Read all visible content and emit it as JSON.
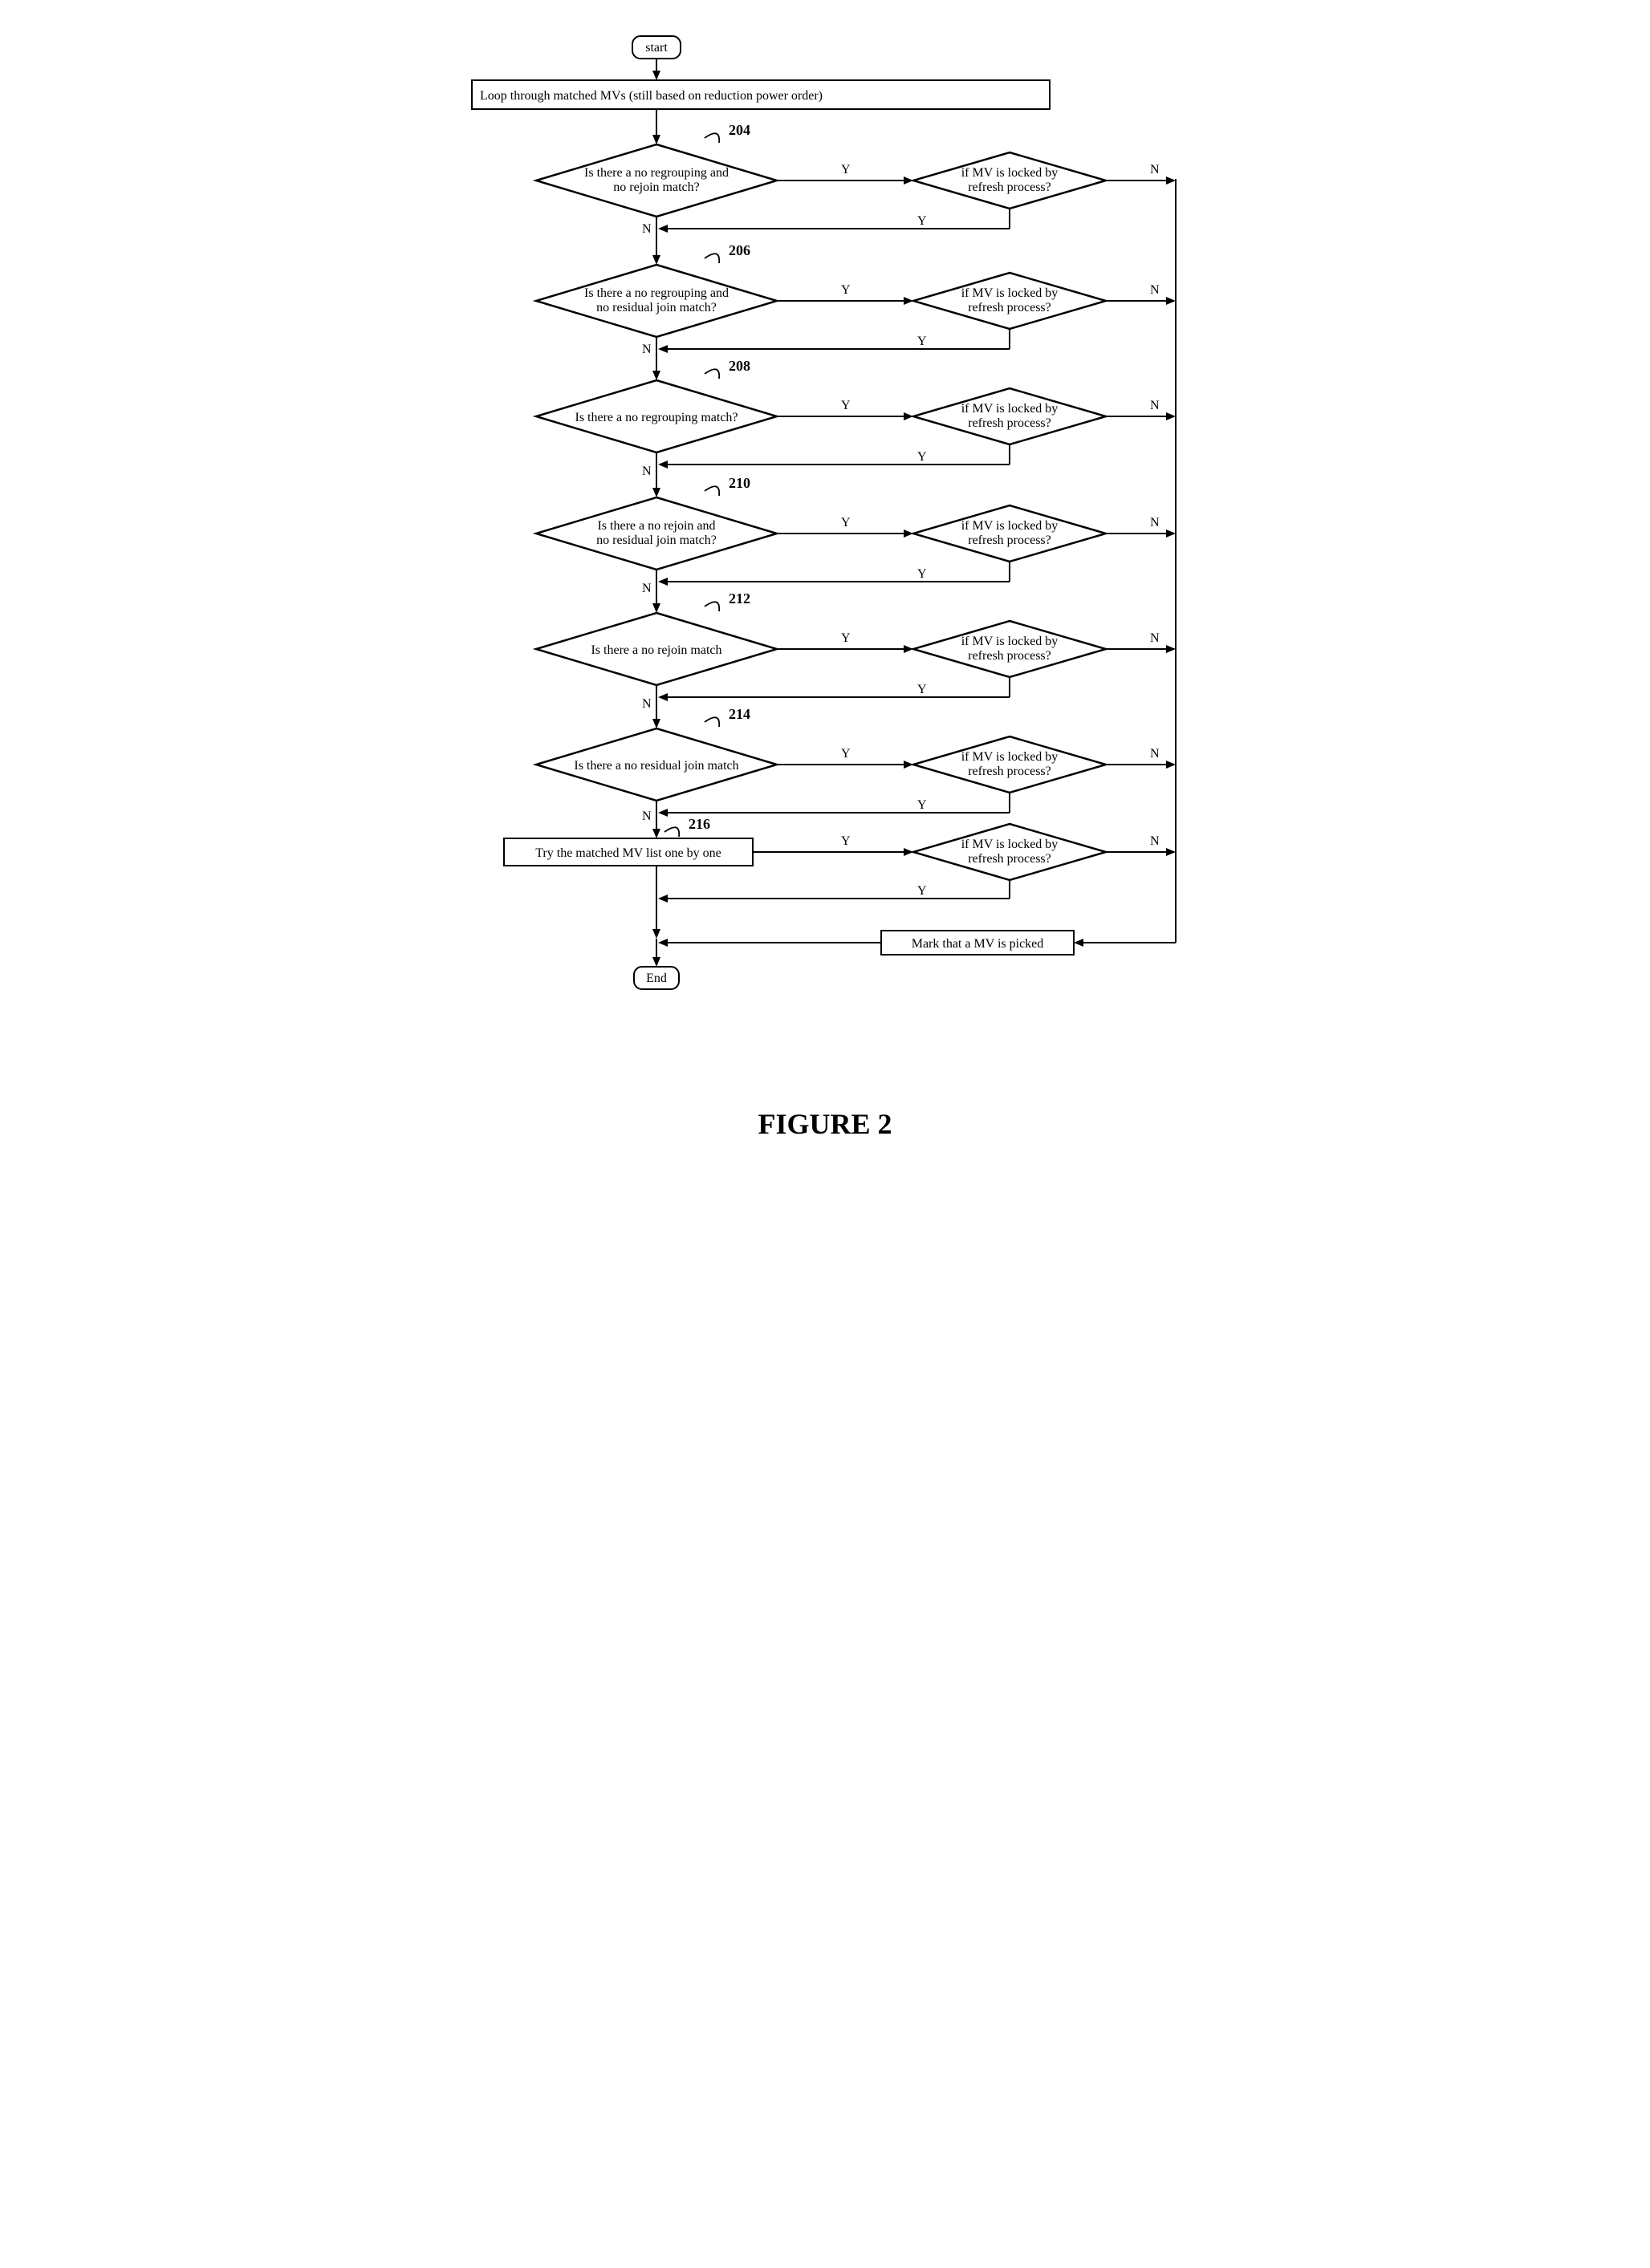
{
  "start": "start",
  "end": "End",
  "step_loop": "Loop through matched MVs  (still based on reduction power order)",
  "d204_l1": "Is there a no regrouping and",
  "d204_l2": "no rejoin match?",
  "d206_l1": "Is there a no regrouping and",
  "d206_l2": "no residual join match?",
  "d208": "Is there a no regrouping match?",
  "d210_l1": "Is there a no rejoin and",
  "d210_l2": "no residual join match?",
  "d212": "Is there a no rejoin match",
  "d214": "Is there a no residual join match",
  "d216": "Try the matched MV list one by one",
  "locked_l1": "if MV is locked by",
  "locked_l2": "refresh process?",
  "mark": "Mark that a MV is picked",
  "lbl204": "204",
  "lbl206": "206",
  "lbl208": "208",
  "lbl210": "210",
  "lbl212": "212",
  "lbl214": "214",
  "lbl216": "216",
  "Y": "Y",
  "N": "N",
  "figure": "FIGURE 2"
}
